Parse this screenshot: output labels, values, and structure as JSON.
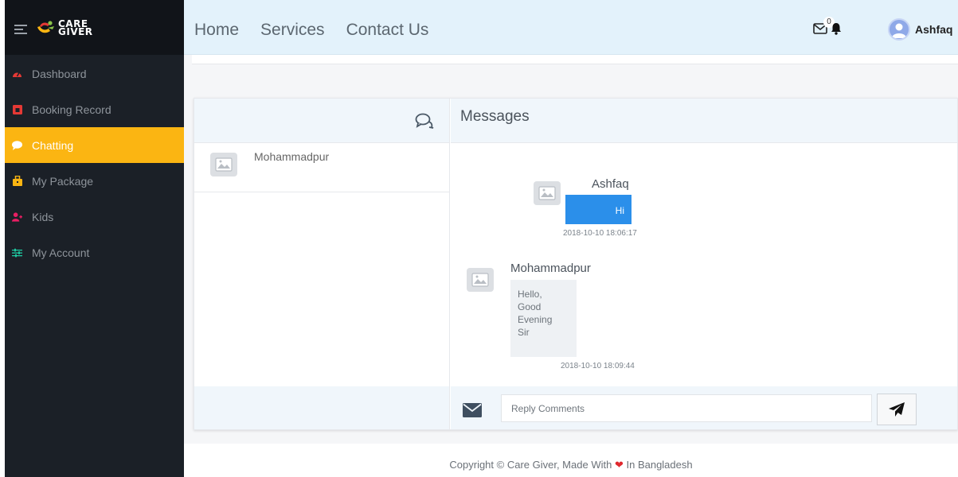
{
  "brand": {
    "logo_line1": "CARE",
    "logo_line2": "GIVER"
  },
  "sidebar": {
    "items": [
      {
        "label": "Dashboard",
        "icon": "tachometer-icon",
        "color": "#e53935"
      },
      {
        "label": "Booking Record",
        "icon": "calendar-icon",
        "color": "#e53935"
      },
      {
        "label": "Chatting",
        "icon": "comment-icon",
        "color": "#ffffff",
        "active": true
      },
      {
        "label": "My Package",
        "icon": "briefcase-icon",
        "color": "#fbb512"
      },
      {
        "label": "Kids",
        "icon": "user-plus-icon",
        "color": "#e91e63"
      },
      {
        "label": "My Account",
        "icon": "sliders-icon",
        "color": "#1ec8a0"
      }
    ]
  },
  "topnav": {
    "home": "Home",
    "services": "Services",
    "contact": "Contact Us"
  },
  "header": {
    "mail_count": "0",
    "username": "Ashfaq"
  },
  "chat": {
    "contacts": [
      {
        "name": "Mohammadpur"
      }
    ],
    "title": "Messages",
    "messages": [
      {
        "sender": "Ashfaq",
        "text": "Hi",
        "time": "2018-10-10 18:06:17"
      },
      {
        "sender": "Mohammadpur",
        "lines": [
          "Hello,",
          "Good",
          "Evening",
          "Sir"
        ],
        "time": "2018-10-10 18:09:44"
      }
    ],
    "reply_placeholder": "Reply Comments"
  },
  "footer": {
    "text_before": "Copyright © Care Giver, Made With",
    "text_after": "In Bangladesh"
  },
  "colors": {
    "accent": "#fbb512",
    "sidebar_bg": "#1b2027",
    "topbar_bg": "#e3f2fb",
    "bubble_blue": "#2b8fea"
  }
}
